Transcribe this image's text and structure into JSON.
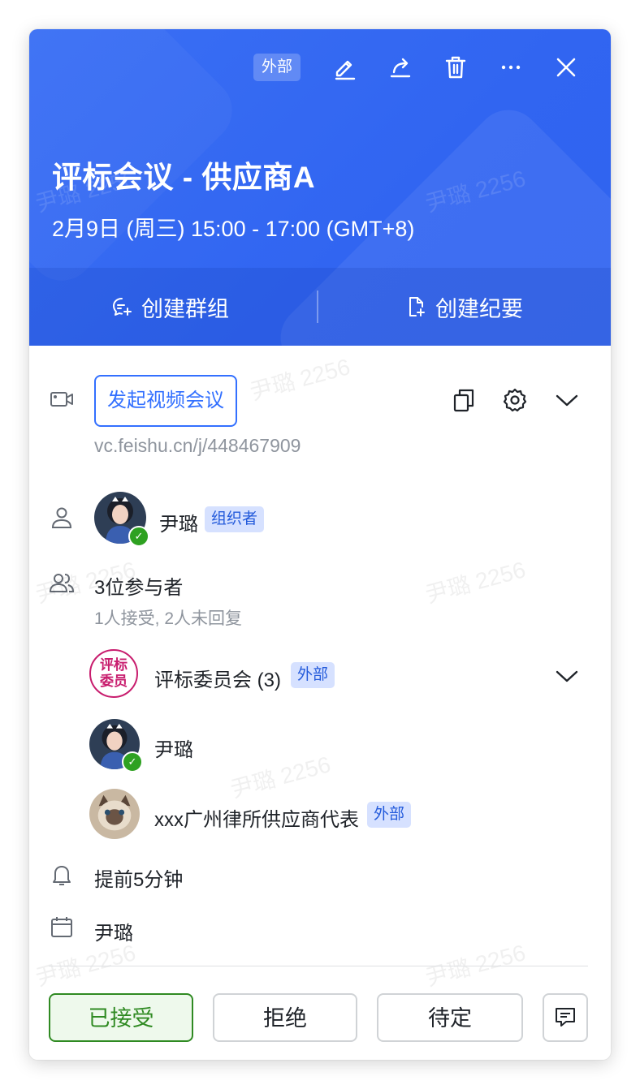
{
  "header": {
    "external_badge": "外部",
    "title": "评标会议 - 供应商A",
    "time": "2月9日 (周三) 15:00 - 17:00 (GMT+8)",
    "actions": {
      "create_group": "创建群组",
      "create_minutes": "创建纪要"
    },
    "toolbar_icons": [
      "edit-icon",
      "share-icon",
      "trash-icon",
      "more-icon",
      "close-icon"
    ]
  },
  "video": {
    "button_label": "发起视频会议",
    "link": "vc.feishu.cn/j/448467909"
  },
  "organizer": {
    "name": "尹璐",
    "role_tag": "组织者"
  },
  "attendees": {
    "summary": "3位参与者",
    "status": "1人接受, 2人未回复",
    "group": {
      "avatar_text": "评标委员",
      "name": "评标委员会 (3)",
      "tag": "外部"
    },
    "people": [
      {
        "name": "尹璐"
      },
      {
        "name": "xxx广州律所供应商代表",
        "tag": "外部"
      }
    ]
  },
  "reminder": "提前5分钟",
  "calendar_owner": "尹璐",
  "footer": {
    "accept": "已接受",
    "decline": "拒绝",
    "tentative": "待定"
  },
  "watermark": "尹璐 2256",
  "colors": {
    "header_blue": "#3368f2",
    "accent": "#3370ff",
    "accept_green": "#2f8a22",
    "tag_bg": "#d6e1ff"
  }
}
